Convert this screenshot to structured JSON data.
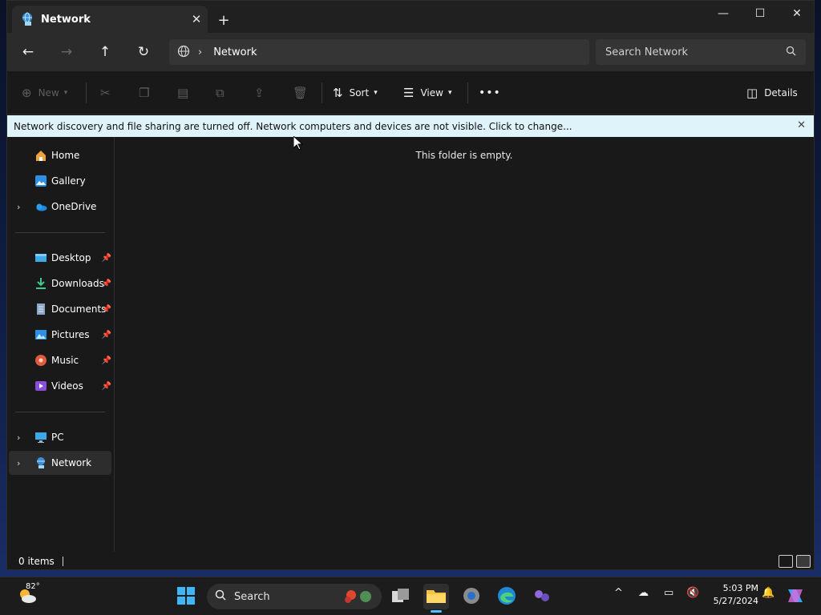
{
  "window": {
    "tab_title": "Network",
    "new_tab": "+",
    "controls": {
      "minimize": "—",
      "maximize": "☐",
      "close": "✕"
    }
  },
  "nav": {
    "back": "←",
    "forward": "→",
    "up": "↑",
    "refresh": "↻",
    "breadcrumb": [
      "Network"
    ],
    "search_placeholder": "Search Network"
  },
  "commandbar": {
    "new_label": "New",
    "sort_label": "Sort",
    "view_label": "View",
    "more_label": "•••",
    "details_label": "Details"
  },
  "infobar": {
    "message": "Network discovery and file sharing are turned off. Network computers and devices are not visible. Click to change..."
  },
  "sidebar": {
    "top_items": [
      {
        "label": "Home",
        "icon": "home-icon",
        "expandable": false
      },
      {
        "label": "Gallery",
        "icon": "gallery-icon",
        "expandable": false
      },
      {
        "label": "OneDrive",
        "icon": "onedrive-icon",
        "expandable": true
      }
    ],
    "pinned_items": [
      {
        "label": "Desktop",
        "icon": "desktop-folder-icon"
      },
      {
        "label": "Downloads",
        "icon": "downloads-icon"
      },
      {
        "label": "Documents",
        "icon": "documents-icon"
      },
      {
        "label": "Pictures",
        "icon": "pictures-icon"
      },
      {
        "label": "Music",
        "icon": "music-icon"
      },
      {
        "label": "Videos",
        "icon": "videos-icon"
      }
    ],
    "bottom_items": [
      {
        "label": "PC",
        "icon": "pc-icon",
        "selected": false
      },
      {
        "label": "Network",
        "icon": "network-icon",
        "selected": true
      }
    ]
  },
  "content": {
    "empty_message": "This folder is empty."
  },
  "status": {
    "item_count": "0 items"
  },
  "taskbar": {
    "weather_temp": "82°",
    "search_label": "Search",
    "time": "5:03 PM",
    "date": "5/27/2024",
    "tray_chevron": "^"
  },
  "colors": {
    "window_bg": "#191919",
    "infobar_bg": "#dff3fb",
    "selected_item": "#2d2d2d",
    "accent": "#4cc2ff"
  }
}
